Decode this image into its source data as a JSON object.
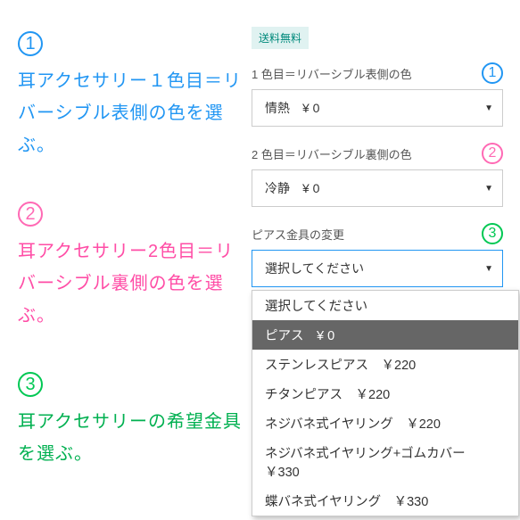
{
  "left": {
    "step1": {
      "num": "1",
      "text": "耳アクセサリー１色目＝リバーシブル表側の色を選ぶ。"
    },
    "step2": {
      "num": "2",
      "text": "耳アクセサリー2色目＝リバーシブル裏側の色を選ぶ。"
    },
    "step3": {
      "num": "3",
      "text": "耳アクセサリーの希望金具を選ぶ。"
    }
  },
  "right": {
    "badge": "送料無料",
    "field1": {
      "label": "1 色目＝リバーシブル表側の色",
      "num": "1",
      "value": "情熱　¥ 0"
    },
    "field2": {
      "label": "2 色目＝リバーシブル裏側の色",
      "num": "2",
      "value": "冷静　¥ 0"
    },
    "field3": {
      "label": "ピアス金具の変更",
      "num": "3",
      "value": "選択してください"
    },
    "options": [
      "選択してください",
      "ピアス　¥ 0",
      "ステンレスピアス　￥220",
      "チタンピアス　￥220",
      "ネジバネ式イヤリング　￥220",
      "ネジバネ式イヤリング+ゴムカバー　￥330",
      "蝶バネ式イヤリング　￥330"
    ]
  }
}
